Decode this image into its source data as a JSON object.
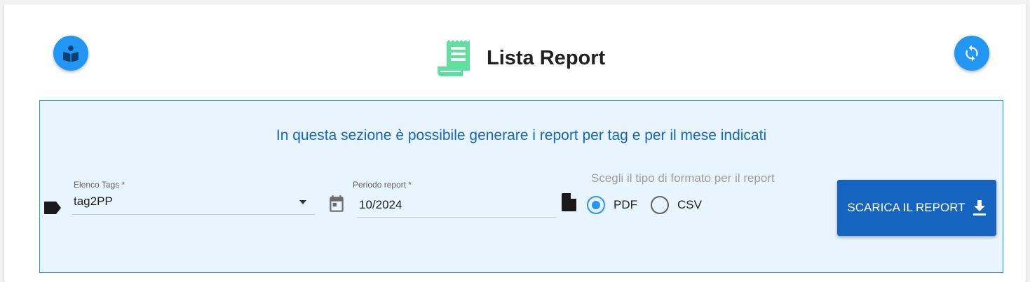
{
  "header": {
    "title": "Lista Report",
    "left_button_icon": "book-reader-icon",
    "right_button_icon": "refresh-icon",
    "title_icon": "receipt-icon"
  },
  "panel": {
    "intro": "In questa sezione è possibile generare i report per tag e per il mese indicati",
    "tags": {
      "label": "Elenco Tags *",
      "value": "tag2PP",
      "icon": "label-icon"
    },
    "period": {
      "label": "Periodo report *",
      "value": "10/2024",
      "icon": "calendar-icon"
    },
    "format": {
      "label": "Scegli il tipo di formato per il report",
      "icon": "file-icon",
      "options": [
        {
          "label": "PDF",
          "selected": true
        },
        {
          "label": "CSV",
          "selected": false
        }
      ]
    },
    "download": {
      "label": "SCARICA IL REPORT",
      "icon": "download-icon"
    }
  },
  "colors": {
    "accent": "#2196f3",
    "button": "#1565c0",
    "panel_bg": "#e8f4fe",
    "title_icon": "#5ee0a0"
  }
}
